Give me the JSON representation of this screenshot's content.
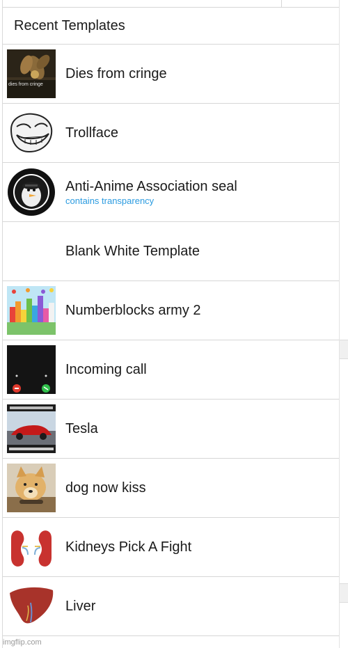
{
  "panel": {
    "title": "Recent Templates"
  },
  "templates": [
    {
      "label": "Dies from cringe",
      "sublabel": "",
      "thumb_icon": "cringe-thumbnail",
      "thumb_caption": "dies from cringe"
    },
    {
      "label": "Trollface",
      "sublabel": "",
      "thumb_icon": "trollface-thumbnail"
    },
    {
      "label": "Anti-Anime Association seal",
      "sublabel": "contains transparency",
      "thumb_icon": "seal-thumbnail"
    },
    {
      "label": "Blank White Template",
      "sublabel": "",
      "thumb_icon": "blank-thumbnail"
    },
    {
      "label": "Numberblocks army 2",
      "sublabel": "",
      "thumb_icon": "numberblocks-thumbnail"
    },
    {
      "label": "Incoming call",
      "sublabel": "",
      "thumb_icon": "phone-call-thumbnail"
    },
    {
      "label": "Tesla",
      "sublabel": "",
      "thumb_icon": "car-thumbnail"
    },
    {
      "label": "dog now kiss",
      "sublabel": "",
      "thumb_icon": "dog-thumbnail"
    },
    {
      "label": "Kidneys Pick A Fight",
      "sublabel": "",
      "thumb_icon": "kidneys-thumbnail"
    },
    {
      "label": "Liver",
      "sublabel": "",
      "thumb_icon": "liver-thumbnail"
    }
  ],
  "watermark": "imgflip.com",
  "colors": {
    "sublabel_accent": "#2b9be0",
    "divider": "#d6d6d6"
  }
}
